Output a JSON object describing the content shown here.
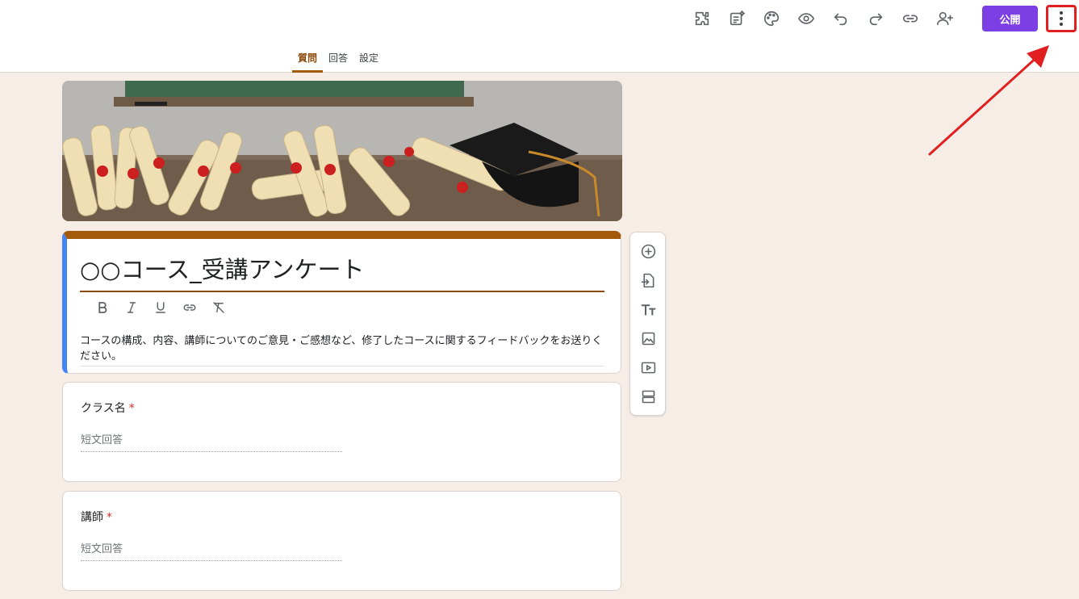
{
  "toolbar": {
    "icons": [
      "puzzle-icon",
      "ai-form-icon",
      "palette-icon",
      "eye-icon",
      "undo-icon",
      "redo-icon",
      "link-icon",
      "add-person-icon"
    ],
    "publish_label": "公開",
    "more_icon": "more-vert-icon"
  },
  "tabs": [
    {
      "label": "質問",
      "active": true
    },
    {
      "label": "回答",
      "active": false
    },
    {
      "label": "設定",
      "active": false
    }
  ],
  "form": {
    "title": "○○コース_受講アンケート",
    "description": "コースの構成、内容、講師についてのご意見・ご感想など、修了したコースに関するフィードバックをお送りください。",
    "format_tools": [
      "bold-icon",
      "italic-icon",
      "underline-icon",
      "link-icon",
      "clear-format-icon"
    ],
    "questions": [
      {
        "label": "クラス名",
        "required_mark": "*",
        "placeholder": "短文回答"
      },
      {
        "label": "講師",
        "required_mark": "*",
        "placeholder": "短文回答"
      }
    ]
  },
  "side_tools": [
    "add-question-icon",
    "import-questions-icon",
    "add-title-icon",
    "add-image-icon",
    "add-video-icon",
    "add-section-icon"
  ],
  "colors": {
    "accent": "#a35a0b",
    "publish": "#7b3fe4",
    "background": "#f6ede7",
    "highlight": "#e02020",
    "active_border": "#4285f4"
  }
}
